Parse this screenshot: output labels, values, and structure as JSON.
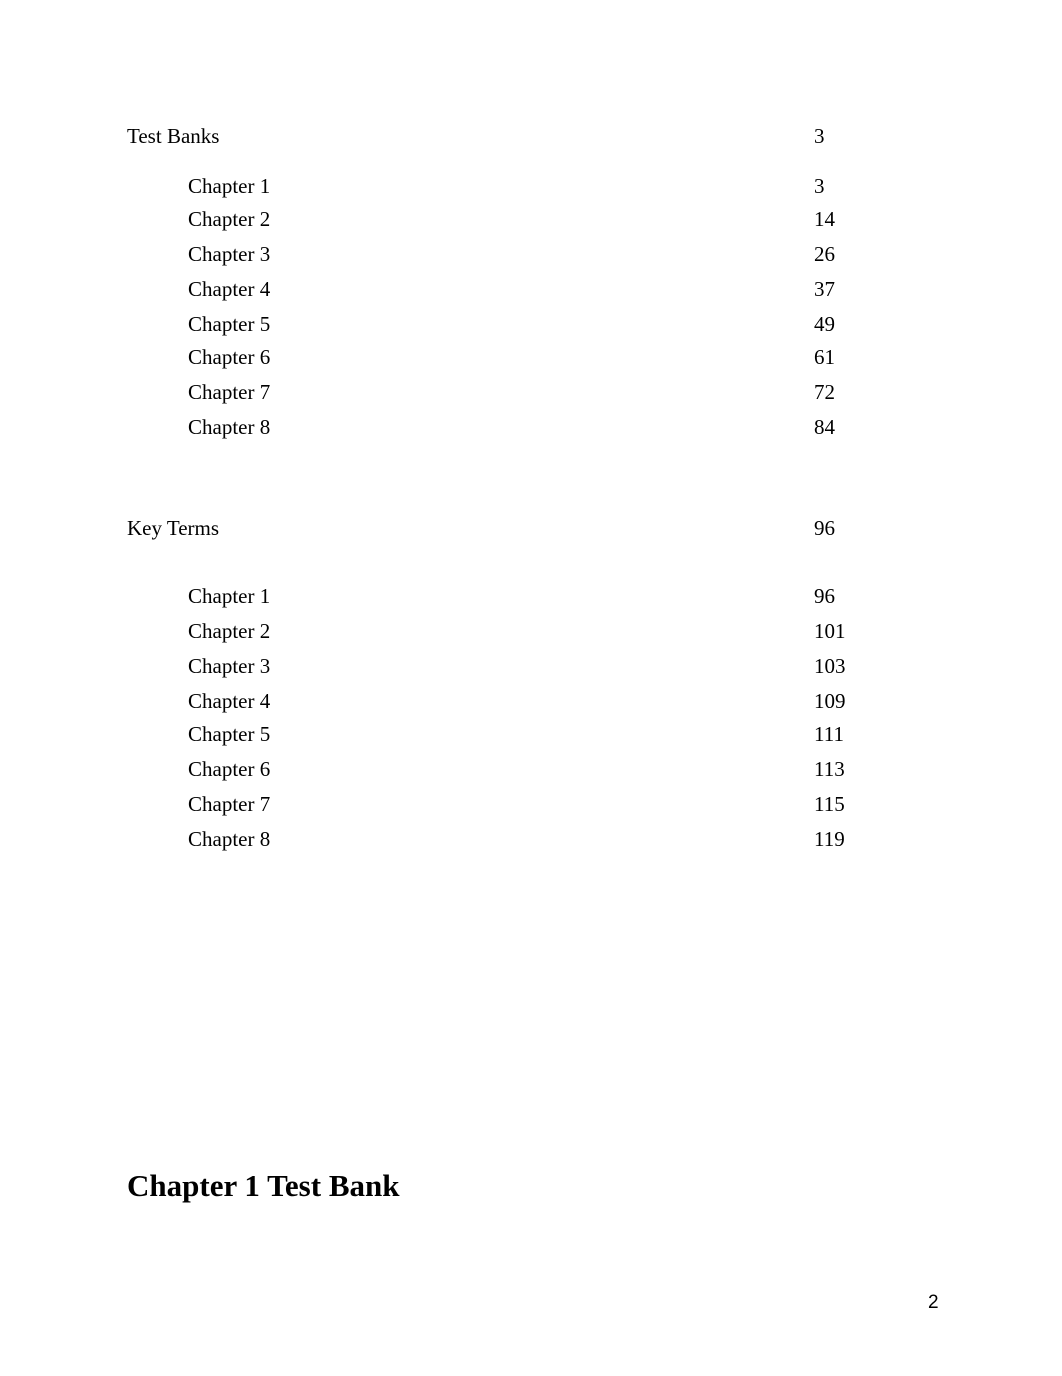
{
  "toc": {
    "sections": [
      {
        "title": "Test Banks",
        "page": "3",
        "entries": [
          {
            "label": "Chapter 1",
            "page": "3"
          },
          {
            "label": "Chapter 2",
            "page": "14"
          },
          {
            "label": "Chapter 3",
            "page": "26"
          },
          {
            "label": "Chapter 4",
            "page": "37"
          },
          {
            "label": "Chapter 5",
            "page": "49"
          },
          {
            "label": "Chapter 6",
            "page": "61"
          },
          {
            "label": "Chapter 7",
            "page": "72"
          },
          {
            "label": "Chapter 8",
            "page": "84"
          }
        ]
      },
      {
        "title": "Key Terms",
        "page": "96",
        "entries": [
          {
            "label": "Chapter 1",
            "page": "96"
          },
          {
            "label": "Chapter 2",
            "page": "101"
          },
          {
            "label": "Chapter 3",
            "page": "103"
          },
          {
            "label": "Chapter 4",
            "page": "109"
          },
          {
            "label": "Chapter 5",
            "page": "111"
          },
          {
            "label": "Chapter 6",
            "page": "113"
          },
          {
            "label": "Chapter 7",
            "page": "115"
          },
          {
            "label": "Chapter 8",
            "page": "119"
          }
        ]
      }
    ]
  },
  "heading": "Chapter 1 Test Bank",
  "footer": {
    "page_number": "2"
  }
}
